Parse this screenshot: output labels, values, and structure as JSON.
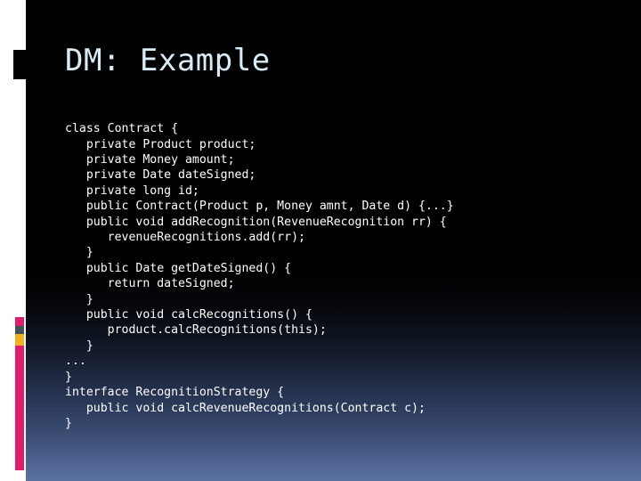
{
  "slide": {
    "title": "DM: Example",
    "background": {
      "top_color": "#000000",
      "bottom_color": "#5a719f",
      "margin_color": "#ffffff"
    }
  },
  "accents": {
    "block_color": "#000000",
    "bar_segments": [
      {
        "name": "magenta-top",
        "color": "#e31b6d"
      },
      {
        "name": "slate",
        "color": "#44525a"
      },
      {
        "name": "amber",
        "color": "#f6b01e"
      },
      {
        "name": "magenta-long",
        "color": "#e31b6d"
      }
    ]
  },
  "code": {
    "language": "java",
    "lines": [
      "class Contract {",
      "   private Product product;",
      "   private Money amount;",
      "   private Date dateSigned;",
      "   private long id;",
      "   public Contract(Product p, Money amnt, Date d) {...}",
      "   public void addRecognition(RevenueRecognition rr) {",
      "      revenueRecognitions.add(rr);",
      "   }",
      "   public Date getDateSigned() {",
      "      return dateSigned;",
      "   }",
      "   public void calcRecognitions() {",
      "      product.calcRecognitions(this);",
      "   }",
      "...",
      "}",
      "interface RecognitionStrategy {",
      "   public void calcRevenueRecognitions(Contract c);",
      "}"
    ]
  }
}
